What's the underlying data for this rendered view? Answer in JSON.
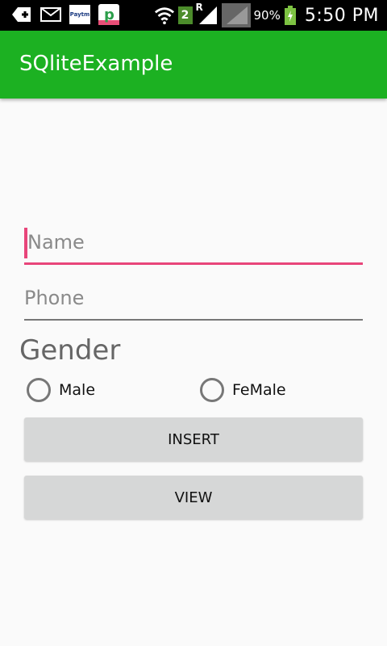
{
  "status_bar": {
    "paytm_label": "Paytm",
    "sim_slot": "2",
    "roaming": "R",
    "battery": "90%",
    "time": "5:50 PM"
  },
  "app_bar": {
    "title": "SQliteExample"
  },
  "form": {
    "name_placeholder": "Name",
    "phone_placeholder": "Phone",
    "gender_label": "Gender",
    "gender_options": [
      "Male",
      "FeMale"
    ],
    "insert_label": "INSERT",
    "view_label": "VIEW"
  },
  "colors": {
    "app_bar": "#1cb122",
    "focus_accent": "#e8457a",
    "button_bg": "#d6d7d7"
  }
}
